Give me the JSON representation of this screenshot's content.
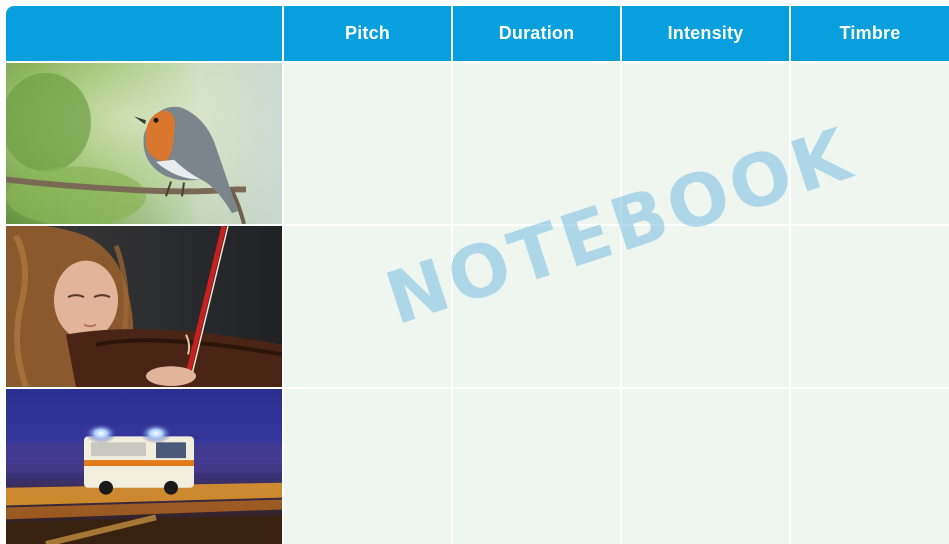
{
  "table": {
    "headers": [
      "",
      "Pitch",
      "Duration",
      "Intensity",
      "Timbre"
    ],
    "rows": [
      {
        "image": "robin-bird-singing",
        "cells": [
          "",
          "",
          "",
          ""
        ]
      },
      {
        "image": "girl-playing-violin",
        "cells": [
          "",
          "",
          "",
          ""
        ]
      },
      {
        "image": "ambulance-at-night",
        "cells": [
          "",
          "",
          "",
          ""
        ]
      }
    ]
  },
  "watermark": "NOTEBOOK",
  "colors": {
    "header_bg": "#079fdd",
    "header_text": "#ffffff",
    "cell_bg": "#eef6ef",
    "watermark": "#78bee1"
  }
}
